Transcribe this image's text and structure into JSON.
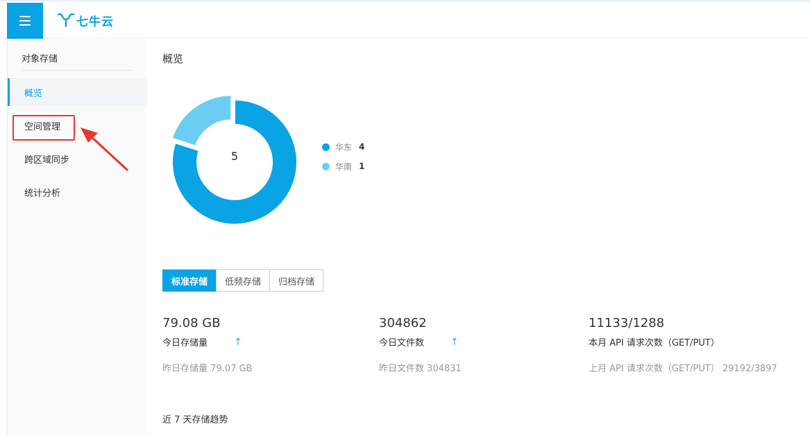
{
  "header": {
    "logo_text": "七牛云"
  },
  "sidebar": {
    "title": "对象存储",
    "items": [
      {
        "label": "概览",
        "active": true
      },
      {
        "label": "空间管理",
        "active": false
      },
      {
        "label": "跨区域同步",
        "active": false
      },
      {
        "label": "统计分析",
        "active": false
      }
    ]
  },
  "main": {
    "title": "概览",
    "donut": {
      "total": "5",
      "segments": [
        {
          "name": "华东",
          "value": 4,
          "color": "#0aa3e3"
        },
        {
          "name": "华南",
          "value": 1,
          "color": "#6ccdf2"
        }
      ]
    },
    "tabs": [
      {
        "label": "标准存储",
        "active": true
      },
      {
        "label": "低频存储",
        "active": false
      },
      {
        "label": "归档存储",
        "active": false
      }
    ],
    "stats": [
      {
        "value": "79.08 GB",
        "label": "今日存储量",
        "trend": "up",
        "sub": "昨日存储量 79.07 GB"
      },
      {
        "value": "304862",
        "label": "今日文件数",
        "trend": "up",
        "sub": "昨日文件数 304831"
      },
      {
        "value": "11133/1288",
        "label": "本月 API 请求次数（GET/PUT）",
        "trend": "",
        "sub": "上月 API 请求次数（GET/PUT） 29192/3897"
      }
    ],
    "trend_title": "近 7 天存储趋势"
  },
  "colors": {
    "accent": "#0aa3e3",
    "secondary": "#6ccdf2",
    "annotation": "#e23b2e"
  }
}
